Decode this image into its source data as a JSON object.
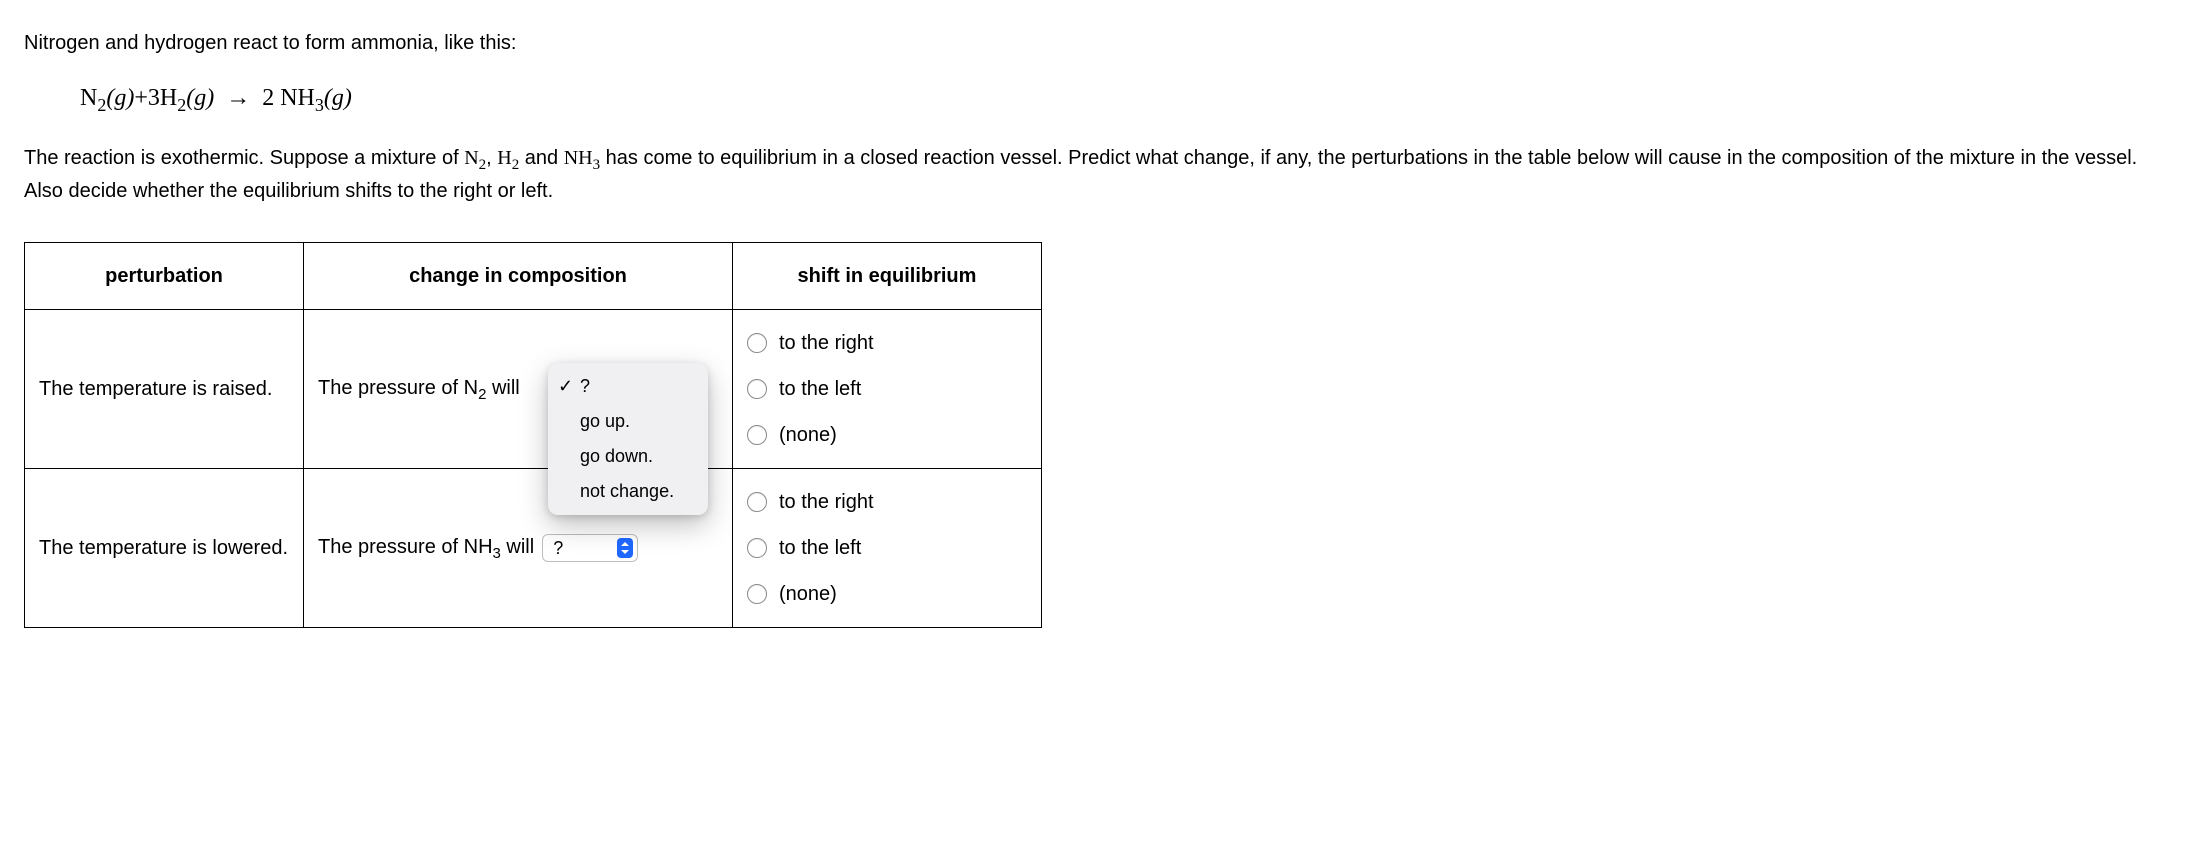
{
  "intro": {
    "line1": "Nitrogen and hydrogen react to form ammonia, like this:",
    "line2_pre": "The reaction is exothermic. Suppose a mixture of ",
    "line2_mid1": ", ",
    "line2_mid2": " and ",
    "line2_post": " has come to equilibrium in a closed reaction vessel. Predict what change, if any, the perturbations in the table below will cause in the composition of the mixture in the vessel. Also decide whether the equilibrium shifts to the right or left.",
    "species_n2": "N",
    "species_n2_sub": "2",
    "species_h2": "H",
    "species_h2_sub": "2",
    "species_nh3": "NH",
    "species_nh3_sub": "3"
  },
  "equation": {
    "n2": "N",
    "n2_sub": "2",
    "g1": "(g)",
    "plus": "+",
    "coef3": "3",
    "h2": "H",
    "h2_sub": "2",
    "g2": "(g)",
    "arrow": "→",
    "coef2": "2",
    "nh": "NH",
    "nh3_sub": "3",
    "g3": "(g)"
  },
  "table": {
    "headers": {
      "perturbation": "perturbation",
      "change": "change in composition",
      "shift": "shift in equilibrium"
    },
    "rows": [
      {
        "perturbation": "The temperature is raised.",
        "change_label_pre": "The pressure of N",
        "change_label_sub": "2",
        "change_label_post": " will",
        "dropdown": {
          "open": true,
          "selected": "?",
          "options": [
            "?",
            "go up.",
            "go down.",
            "not change."
          ]
        },
        "radios": [
          "to the right",
          "to the left",
          "(none)"
        ]
      },
      {
        "perturbation": "The temperature is lowered.",
        "change_label_pre": "The pressure of NH",
        "change_label_sub": "3",
        "change_label_post": " will",
        "dropdown": {
          "open": false,
          "selected": "?"
        },
        "radios": [
          "to the right",
          "to the left",
          "(none)"
        ]
      }
    ]
  }
}
